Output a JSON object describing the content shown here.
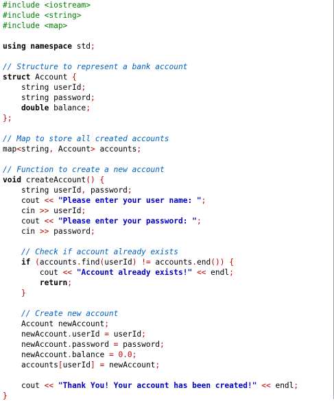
{
  "colors": {
    "background": "#ffffff",
    "keyword": "#000000",
    "preprocessor": "#008000",
    "comment": "#0060c0",
    "string": "#0000c0",
    "operator": "#c00000",
    "number": "#c00000",
    "text": "#000000"
  },
  "code": {
    "lines": [
      [
        {
          "t": "pp",
          "v": "#include <iostream>"
        }
      ],
      [
        {
          "t": "pp",
          "v": "#include <string>"
        }
      ],
      [
        {
          "t": "pp",
          "v": "#include <map>"
        }
      ],
      [],
      [
        {
          "t": "kw",
          "v": "using namespace"
        },
        {
          "t": "tx",
          "v": " std"
        },
        {
          "t": "op",
          "v": ";"
        }
      ],
      [],
      [
        {
          "t": "cm",
          "v": "// Structure to represent a bank account"
        }
      ],
      [
        {
          "t": "kw",
          "v": "struct"
        },
        {
          "t": "tx",
          "v": " Account "
        },
        {
          "t": "op",
          "v": "{"
        }
      ],
      [
        {
          "t": "tx",
          "v": "    string userId"
        },
        {
          "t": "op",
          "v": ";"
        }
      ],
      [
        {
          "t": "tx",
          "v": "    string password"
        },
        {
          "t": "op",
          "v": ";"
        }
      ],
      [
        {
          "t": "kw",
          "v": "    double"
        },
        {
          "t": "tx",
          "v": " balance"
        },
        {
          "t": "op",
          "v": ";"
        }
      ],
      [
        {
          "t": "op",
          "v": "};"
        }
      ],
      [],
      [
        {
          "t": "cm",
          "v": "// Map to store all created accounts"
        }
      ],
      [
        {
          "t": "tx",
          "v": "map"
        },
        {
          "t": "op",
          "v": "<"
        },
        {
          "t": "tx",
          "v": "string"
        },
        {
          "t": "op",
          "v": ","
        },
        {
          "t": "tx",
          "v": " Account"
        },
        {
          "t": "op",
          "v": ">"
        },
        {
          "t": "tx",
          "v": " accounts"
        },
        {
          "t": "op",
          "v": ";"
        }
      ],
      [],
      [
        {
          "t": "cm",
          "v": "// Function to create a new account"
        }
      ],
      [
        {
          "t": "kw",
          "v": "void"
        },
        {
          "t": "tx",
          "v": " createAccount"
        },
        {
          "t": "op",
          "v": "()"
        },
        {
          "t": "tx",
          "v": " "
        },
        {
          "t": "op",
          "v": "{"
        }
      ],
      [
        {
          "t": "tx",
          "v": "    string userId"
        },
        {
          "t": "op",
          "v": ","
        },
        {
          "t": "tx",
          "v": " password"
        },
        {
          "t": "op",
          "v": ";"
        }
      ],
      [
        {
          "t": "tx",
          "v": "    cout "
        },
        {
          "t": "op",
          "v": "<<"
        },
        {
          "t": "tx",
          "v": " "
        },
        {
          "t": "st",
          "v": "\"Please enter your user name: \""
        },
        {
          "t": "op",
          "v": ";"
        }
      ],
      [
        {
          "t": "tx",
          "v": "    cin "
        },
        {
          "t": "op",
          "v": ">>"
        },
        {
          "t": "tx",
          "v": " userId"
        },
        {
          "t": "op",
          "v": ";"
        }
      ],
      [
        {
          "t": "tx",
          "v": "    cout "
        },
        {
          "t": "op",
          "v": "<<"
        },
        {
          "t": "tx",
          "v": " "
        },
        {
          "t": "st",
          "v": "\"Please enter your password: \""
        },
        {
          "t": "op",
          "v": ";"
        }
      ],
      [
        {
          "t": "tx",
          "v": "    cin "
        },
        {
          "t": "op",
          "v": ">>"
        },
        {
          "t": "tx",
          "v": " password"
        },
        {
          "t": "op",
          "v": ";"
        }
      ],
      [],
      [
        {
          "t": "cm",
          "v": "    // Check if account already exists"
        }
      ],
      [
        {
          "t": "kw",
          "v": "    if"
        },
        {
          "t": "tx",
          "v": " "
        },
        {
          "t": "op",
          "v": "("
        },
        {
          "t": "tx",
          "v": "accounts"
        },
        {
          "t": "op",
          "v": "."
        },
        {
          "t": "tx",
          "v": "find"
        },
        {
          "t": "op",
          "v": "("
        },
        {
          "t": "tx",
          "v": "userId"
        },
        {
          "t": "op",
          "v": ")"
        },
        {
          "t": "tx",
          "v": " "
        },
        {
          "t": "op",
          "v": "!="
        },
        {
          "t": "tx",
          "v": " accounts"
        },
        {
          "t": "op",
          "v": "."
        },
        {
          "t": "tx",
          "v": "end"
        },
        {
          "t": "op",
          "v": "())"
        },
        {
          "t": "tx",
          "v": " "
        },
        {
          "t": "op",
          "v": "{"
        }
      ],
      [
        {
          "t": "tx",
          "v": "        cout "
        },
        {
          "t": "op",
          "v": "<<"
        },
        {
          "t": "tx",
          "v": " "
        },
        {
          "t": "st",
          "v": "\"Account already exists!\""
        },
        {
          "t": "tx",
          "v": " "
        },
        {
          "t": "op",
          "v": "<<"
        },
        {
          "t": "tx",
          "v": " endl"
        },
        {
          "t": "op",
          "v": ";"
        }
      ],
      [
        {
          "t": "kw",
          "v": "        return"
        },
        {
          "t": "op",
          "v": ";"
        }
      ],
      [
        {
          "t": "op",
          "v": "    }"
        }
      ],
      [],
      [
        {
          "t": "cm",
          "v": "    // Create new account"
        }
      ],
      [
        {
          "t": "tx",
          "v": "    Account newAccount"
        },
        {
          "t": "op",
          "v": ";"
        }
      ],
      [
        {
          "t": "tx",
          "v": "    newAccount"
        },
        {
          "t": "op",
          "v": "."
        },
        {
          "t": "tx",
          "v": "userId "
        },
        {
          "t": "op",
          "v": "="
        },
        {
          "t": "tx",
          "v": " userId"
        },
        {
          "t": "op",
          "v": ";"
        }
      ],
      [
        {
          "t": "tx",
          "v": "    newAccount"
        },
        {
          "t": "op",
          "v": "."
        },
        {
          "t": "tx",
          "v": "password "
        },
        {
          "t": "op",
          "v": "="
        },
        {
          "t": "tx",
          "v": " password"
        },
        {
          "t": "op",
          "v": ";"
        }
      ],
      [
        {
          "t": "tx",
          "v": "    newAccount"
        },
        {
          "t": "op",
          "v": "."
        },
        {
          "t": "tx",
          "v": "balance "
        },
        {
          "t": "op",
          "v": "="
        },
        {
          "t": "tx",
          "v": " "
        },
        {
          "t": "nm",
          "v": "0.0"
        },
        {
          "t": "op",
          "v": ";"
        }
      ],
      [
        {
          "t": "tx",
          "v": "    accounts"
        },
        {
          "t": "op",
          "v": "["
        },
        {
          "t": "tx",
          "v": "userId"
        },
        {
          "t": "op",
          "v": "]"
        },
        {
          "t": "tx",
          "v": " "
        },
        {
          "t": "op",
          "v": "="
        },
        {
          "t": "tx",
          "v": " newAccount"
        },
        {
          "t": "op",
          "v": ";"
        }
      ],
      [],
      [
        {
          "t": "tx",
          "v": "    cout "
        },
        {
          "t": "op",
          "v": "<<"
        },
        {
          "t": "tx",
          "v": " "
        },
        {
          "t": "st",
          "v": "\"Thank You! Your account has been created!\""
        },
        {
          "t": "tx",
          "v": " "
        },
        {
          "t": "op",
          "v": "<<"
        },
        {
          "t": "tx",
          "v": " endl"
        },
        {
          "t": "op",
          "v": ";"
        }
      ],
      [
        {
          "t": "op",
          "v": "}"
        }
      ]
    ]
  }
}
